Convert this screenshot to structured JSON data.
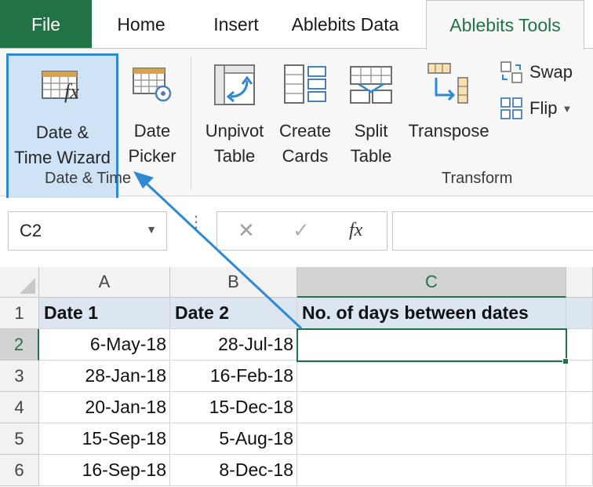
{
  "tabs": {
    "file": "File",
    "home": "Home",
    "insert": "Insert",
    "ablebits_data": "Ablebits Data",
    "ablebits_tools": "Ablebits Tools"
  },
  "ribbon": {
    "date_time_wizard": {
      "line1": "Date &",
      "line2": "Time Wizard"
    },
    "date_picker": {
      "line1": "Date",
      "line2": "Picker"
    },
    "unpivot_table": {
      "line1": "Unpivot",
      "line2": "Table"
    },
    "create_cards": {
      "line1": "Create",
      "line2": "Cards"
    },
    "split_table": {
      "line1": "Split",
      "line2": "Table"
    },
    "transpose": {
      "line1": "Transpose"
    },
    "swap": "Swap",
    "flip": "Flip",
    "groups": {
      "date_time": "Date & Time",
      "transform": "Transform"
    }
  },
  "formula_bar": {
    "name_box": "C2",
    "fx_label": "fx",
    "formula": ""
  },
  "grid": {
    "columns": [
      "A",
      "B",
      "C"
    ],
    "selected_column": "C",
    "selected_cell": "C2",
    "rows": [
      {
        "num": "1",
        "a": "Date 1",
        "b": "Date 2",
        "c": "No. of days between dates"
      },
      {
        "num": "2",
        "a": "6-May-18",
        "b": "28-Jul-18",
        "c": ""
      },
      {
        "num": "3",
        "a": "28-Jan-18",
        "b": "16-Feb-18",
        "c": ""
      },
      {
        "num": "4",
        "a": "20-Jan-18",
        "b": "15-Dec-18",
        "c": ""
      },
      {
        "num": "5",
        "a": "15-Sep-18",
        "b": "5-Aug-18",
        "c": ""
      },
      {
        "num": "6",
        "a": "16-Sep-18",
        "b": "8-Dec-18",
        "c": ""
      }
    ]
  },
  "colors": {
    "excel_green": "#217346",
    "highlight_blue": "#2d89d2",
    "header_fill": "#dce6f1"
  },
  "icons": {
    "date_time_wizard": "calendar-fx-icon",
    "date_picker": "calendar-target-icon",
    "unpivot": "unpivot-table-icon",
    "create_cards": "cards-icon",
    "split_table": "split-table-icon",
    "transpose": "transpose-icon",
    "swap": "swap-icon",
    "flip": "flip-icon",
    "annotation": "blue-arrow"
  }
}
